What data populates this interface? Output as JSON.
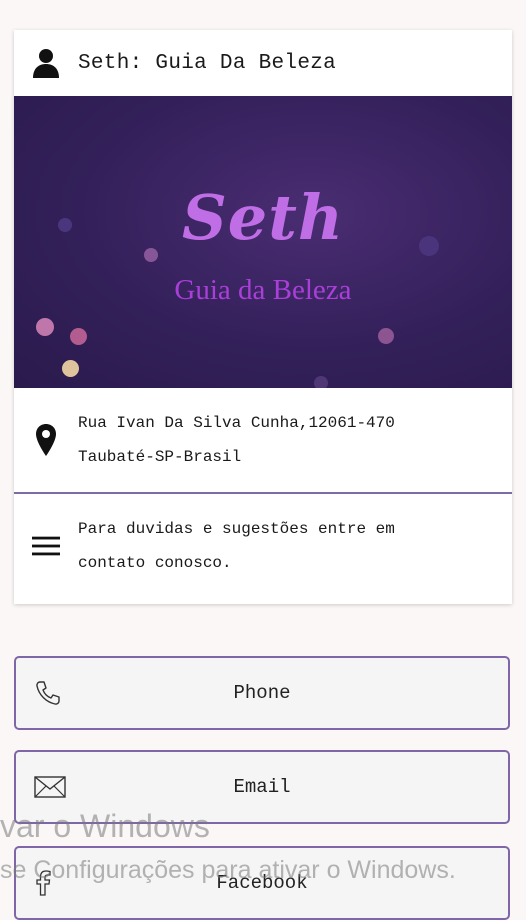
{
  "header": {
    "title": "Seth: Guia Da Beleza",
    "icon": "person-icon"
  },
  "banner": {
    "logo_text": "Seth",
    "tagline": "Guia da Beleza"
  },
  "address": {
    "line1": "Rua Ivan Da Silva Cunha,12061-470",
    "line2": "Taubaté-SP-Brasil",
    "icon": "location-pin-icon"
  },
  "description": {
    "line1": "Para duvidas e sugestões entre em",
    "line2": "contato conosco.",
    "icon": "menu-icon"
  },
  "buttons": {
    "phone": "Phone",
    "email": "Email",
    "facebook": "Facebook"
  },
  "watermark": {
    "line1": "var o Windows",
    "line2": "se Configurações para ativar o Windows."
  },
  "colors": {
    "accent": "#7e66a8",
    "banner_bg": "#33205a",
    "logo": "#c06ee6"
  }
}
